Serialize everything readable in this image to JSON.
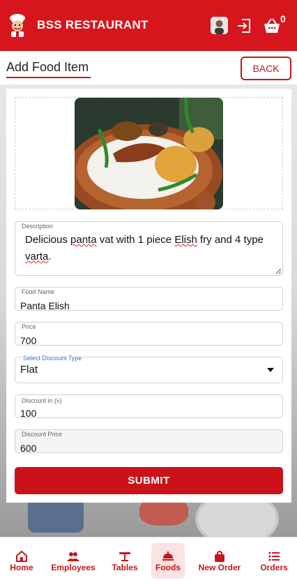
{
  "header": {
    "brand": "BSS RESTAURANT",
    "cart_count": "0",
    "color": "#d6161c"
  },
  "page": {
    "title": "Add Food Item",
    "back_label": "BACK"
  },
  "form": {
    "description": {
      "label": "Description",
      "value_parts": [
        "Delicious ",
        "panta",
        " vat with 1 piece ",
        "Elish",
        " fry and 4 type ",
        "varta",
        "."
      ]
    },
    "food_name": {
      "label": "Food Name",
      "value": "Panta Elish"
    },
    "price": {
      "label": "Price",
      "value": "700"
    },
    "discount_type": {
      "label": "Select Discount Type",
      "value": "Flat"
    },
    "discount_in": {
      "label": "Discount in (৳)",
      "value": "100"
    },
    "discount_price": {
      "label": "Discount Price",
      "value": "600"
    },
    "submit_label": "SUBMIT"
  },
  "nav": [
    {
      "label": "Home",
      "icon": "home-icon"
    },
    {
      "label": "Employees",
      "icon": "employees-icon"
    },
    {
      "label": "Tables",
      "icon": "tables-icon"
    },
    {
      "label": "Foods",
      "icon": "foods-icon",
      "active": true
    },
    {
      "label": "New Order",
      "icon": "shopping-bag-icon"
    },
    {
      "label": "Orders",
      "icon": "list-icon"
    }
  ],
  "colors": {
    "accent": "#c8161b",
    "active_tab_bg": "#fbe3e3"
  }
}
